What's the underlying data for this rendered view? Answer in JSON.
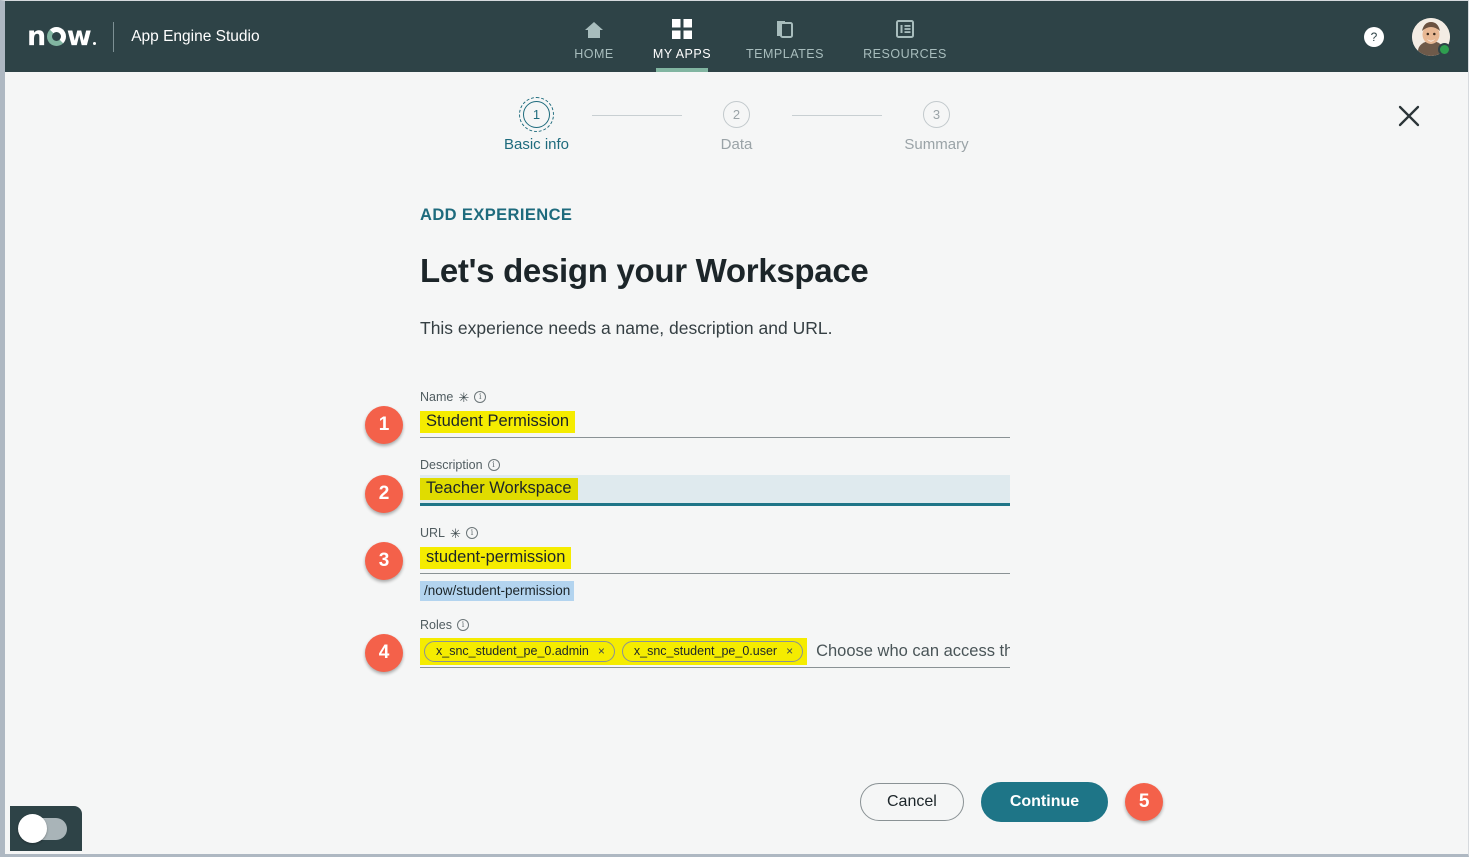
{
  "app": {
    "logo_text_left": "n",
    "logo_text_right": "w",
    "brand_title": "App Engine Studio"
  },
  "nav": {
    "tabs": [
      {
        "label": "HOME",
        "icon": "home-icon",
        "active": false
      },
      {
        "label": "MY APPS",
        "icon": "grid-apps-icon",
        "active": true
      },
      {
        "label": "TEMPLATES",
        "icon": "templates-copy-icon",
        "active": false
      },
      {
        "label": "RESOURCES",
        "icon": "resources-list-icon",
        "active": false
      }
    ],
    "help_label": "?",
    "avatar_name": "user-avatar",
    "status": "online"
  },
  "stepper": {
    "steps": [
      {
        "number": "1",
        "label": "Basic info",
        "active": true
      },
      {
        "number": "2",
        "label": "Data",
        "active": false
      },
      {
        "number": "3",
        "label": "Summary",
        "active": false
      }
    ]
  },
  "modal": {
    "close_label": "✕",
    "eyebrow": "ADD EXPERIENCE",
    "headline": "Let's design your Workspace",
    "subhead": "This experience needs a name, description and URL."
  },
  "form": {
    "name": {
      "label": "Name",
      "required_marker": "✳",
      "info_marker": "i",
      "value": "Student Permission",
      "badge": "1"
    },
    "description": {
      "label": "Description",
      "info_marker": "i",
      "value": "Teacher Workspace",
      "badge": "2"
    },
    "url": {
      "label": "URL",
      "required_marker": "✳",
      "info_marker": "i",
      "value": "student-permission",
      "preview": "/now/student-permission",
      "badge": "3"
    },
    "roles": {
      "label": "Roles",
      "info_marker": "i",
      "chips": [
        {
          "label": "x_snc_student_pe_0.admin",
          "remove": "×"
        },
        {
          "label": "x_snc_student_pe_0.user",
          "remove": "×"
        }
      ],
      "placeholder": "Choose who can access this experience",
      "badge": "4"
    }
  },
  "footer": {
    "cancel_label": "Cancel",
    "continue_label": "Continue",
    "continue_badge": "5"
  },
  "colors": {
    "brand_dark": "#2e4347",
    "accent_teal": "#1e7587",
    "accent_green": "#81b5a1",
    "badge_red": "#f4614a",
    "highlight_yellow": "#f5ec00",
    "selection_blue": "#b3d4ef"
  }
}
